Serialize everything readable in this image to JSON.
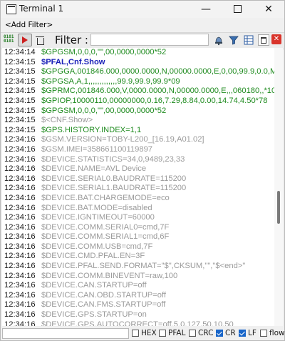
{
  "window": {
    "title": "Terminal 1"
  },
  "filter_bar": {
    "add_filter": "<Add Filter>"
  },
  "toolbar": {
    "bits_icon_text": "0101\n0101",
    "filter_label": "Filter :",
    "filter_value": "",
    "close_glyph": "✕"
  },
  "log": [
    {
      "time": "12:34:14",
      "text": "$GPGSM,0,0,0,\"\",00,0000,0000*52",
      "style": "green"
    },
    {
      "time": "12:34:15",
      "text": "$PFAL,Cnf.Show",
      "style": "blue"
    },
    {
      "time": "12:34:15",
      "text": "$GPGGA,001846.000,0000.0000,N,00000.0000,E,0,00,99.9,0.0,M,",
      "style": "green"
    },
    {
      "time": "12:34:15",
      "text": "$GPGSA,A,1,,,,,,,,,,,,,99.9,99.9,99.9*09",
      "style": "green"
    },
    {
      "time": "12:34:15",
      "text": "$GPRMC,001846.000,V,0000.0000,N,00000.0000,E,,,060180,,*10",
      "style": "green"
    },
    {
      "time": "12:34:15",
      "text": "$GPIOP,10000110,00000000,0.16,7.29,8.84,0.00,14.74,4.50*78",
      "style": "green"
    },
    {
      "time": "12:34:15",
      "text": "$GPGSM,0,0,0,\"\",00,0000,0000*52",
      "style": "green"
    },
    {
      "time": "12:34:15",
      "text": "$<CNF.Show>",
      "style": "gray"
    },
    {
      "time": "12:34:15",
      "text": "$GPS.HISTORY.INDEX=1,1",
      "style": "green"
    },
    {
      "time": "12:34:16",
      "text": "$GSM.VERSION=TOBY-L200_[16.19,A01.02]",
      "style": "gray"
    },
    {
      "time": "12:34:16",
      "text": "$GSM.IMEI=358661100119897",
      "style": "gray"
    },
    {
      "time": "12:34:16",
      "text": "$DEVICE.STATISTICS=34,0,9489,23,33",
      "style": "gray"
    },
    {
      "time": "12:34:16",
      "text": "$DEVICE.NAME=AVL Device",
      "style": "gray"
    },
    {
      "time": "12:34:16",
      "text": "$DEVICE.SERIAL0.BAUDRATE=115200",
      "style": "gray"
    },
    {
      "time": "12:34:16",
      "text": "$DEVICE.SERIAL1.BAUDRATE=115200",
      "style": "gray"
    },
    {
      "time": "12:34:16",
      "text": "$DEVICE.BAT.CHARGEMODE=eco",
      "style": "gray"
    },
    {
      "time": "12:34:16",
      "text": "$DEVICE.BAT.MODE=disabled",
      "style": "gray"
    },
    {
      "time": "12:34:16",
      "text": "$DEVICE.IGNTIMEOUT=60000",
      "style": "gray"
    },
    {
      "time": "12:34:16",
      "text": "$DEVICE.COMM.SERIAL0=cmd,7F",
      "style": "gray"
    },
    {
      "time": "12:34:16",
      "text": "$DEVICE.COMM.SERIAL1=cmd,6F",
      "style": "gray"
    },
    {
      "time": "12:34:16",
      "text": "$DEVICE.COMM.USB=cmd,7F",
      "style": "gray"
    },
    {
      "time": "12:34:16",
      "text": "$DEVICE.CMD.PFAL.EN=3F",
      "style": "gray"
    },
    {
      "time": "12:34:16",
      "text": "$DEVICE.PFAL.SEND.FORMAT=\"$\",CKSUM,\"\",\"$<end>\"",
      "style": "gray"
    },
    {
      "time": "12:34:16",
      "text": "$DEVICE.COMM.BINEVENT=raw,100",
      "style": "gray"
    },
    {
      "time": "12:34:16",
      "text": "$DEVICE.CAN.STARTUP=off",
      "style": "gray"
    },
    {
      "time": "12:34:16",
      "text": "$DEVICE.CAN.OBD.STARTUP=off",
      "style": "gray"
    },
    {
      "time": "12:34:16",
      "text": "$DEVICE.CAN.FMS.STARTUP=off",
      "style": "gray"
    },
    {
      "time": "12:34:16",
      "text": "$DEVICE.GPS.STARTUP=on",
      "style": "gray"
    },
    {
      "time": "12:34:16",
      "text": "$DEVICE.GPS.AUTOCORRECT=off,5.0,127,50,10,50",
      "style": "gray"
    }
  ],
  "options": {
    "hex": {
      "label": "HEX",
      "checked": false
    },
    "pfal": {
      "label": "PFAL",
      "checked": false
    },
    "crc": {
      "label": "CRC",
      "checked": false
    },
    "cr": {
      "label": "CR",
      "checked": true
    },
    "lf": {
      "label": "LF",
      "checked": true
    },
    "flow": {
      "label": "flow",
      "checked": false
    }
  },
  "colors": {
    "log_green": "#1f8b1f",
    "log_gray": "#9a9a9a",
    "log_blue": "#1a20b8",
    "checkbox_checked": "#1865c9",
    "close_red": "#d9342b"
  }
}
